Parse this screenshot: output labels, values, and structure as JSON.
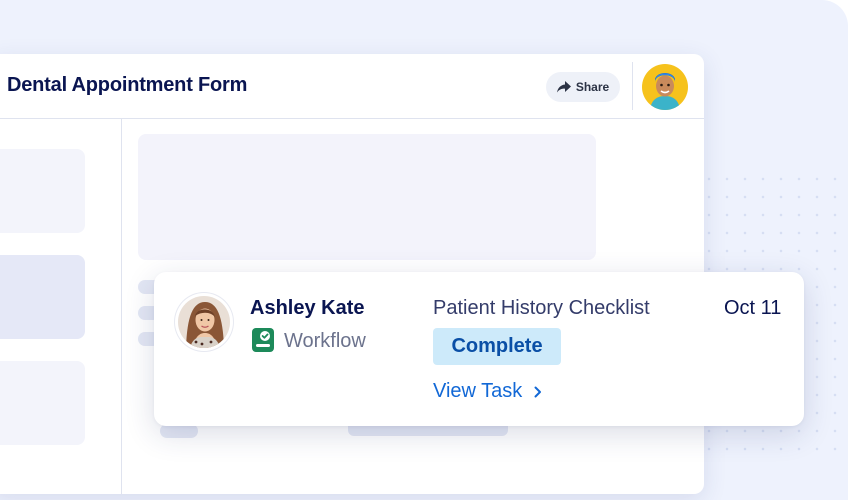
{
  "form": {
    "title": "Dental Appointment Form",
    "share_label": "Share"
  },
  "task_card": {
    "assignee_name": "Ashley Kate",
    "type_label": "Workflow",
    "task_title": "Patient History Checklist",
    "status": "Complete",
    "action_label": "View Task",
    "date": "Oct 11"
  },
  "colors": {
    "title": "#0a1551",
    "status_bg": "#cdeafa",
    "status_text": "#0a4fa6",
    "link": "#1268d6",
    "workflow_icon": "#1d8a5a"
  },
  "icons": [
    "share-arrow-icon",
    "workflow-icon",
    "chevron-right-icon"
  ]
}
